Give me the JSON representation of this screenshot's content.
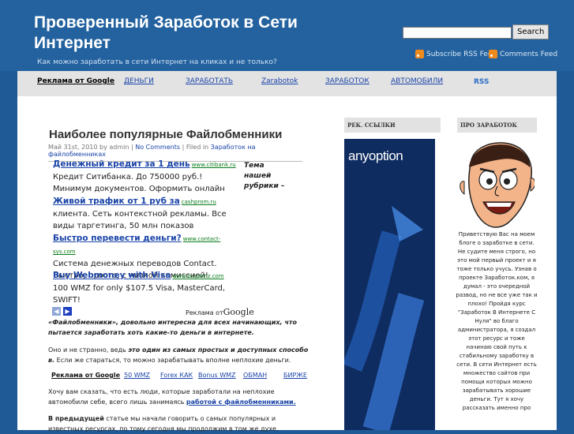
{
  "header": {
    "title": "Проверенный Заработок в Сети Интернет",
    "tagline": "Как можно заработать в сети Интернет на кликах и не только?",
    "search_button": "Search",
    "feed_rss": "Subscribe RSS Feed",
    "feed_comments": "Comments Feed"
  },
  "nav": {
    "items": [
      "Реклама от Google",
      "ДЕНЬГИ",
      "ЗАРАБОТАТЬ",
      "Zarabotok",
      "ЗАРАБОТОК",
      "АВТОМОБИЛИ"
    ],
    "rss": "RSS"
  },
  "post": {
    "title": "Наиболее популярные Файлобменники",
    "meta_date": "Май 31st, 2010 by admin |",
    "meta_comments": "No Comments",
    "meta_filed": "| Filed in",
    "meta_category": "Заработок на файлобменниках",
    "theme_box": "Тема нашей рубрики –"
  },
  "ads": [
    {
      "title": "Денежный кредит за 1 день",
      "url": "www.citibank.ru",
      "text": "Кредит Ситибанка. До 750000 руб.! Минимум документов. Оформить онлайн"
    },
    {
      "title": "Живой трафик от 1 руб за",
      "url": "cashprom.ru",
      "text": "клиента. Сеть контекстной рекламы. Все виды таргетинга, 50 млн показов"
    },
    {
      "title": "Быстро перевести деньги?",
      "url": "www.contact-sys.com",
      "text": "Система денежных переводов Contact. Быстро, просто, с низкой комиссией!"
    },
    {
      "title": "Buy Webmoney with Visa",
      "url": "www.buywmz.com",
      "text": "100 WMZ for only $107.5 Visa, MasterCard, SWIFT!"
    }
  ],
  "ads_label": {
    "prefix": "Реклама от",
    "brand": "Google"
  },
  "content": {
    "p1": "«Файлобменники», довольно интересна для всех начинающих, что пытается заработать хоть какие-то деньги в интернете.",
    "p2_a": "Оно и не странно, ведь",
    "p2_b": "это один из самых простых и доступных способо в.",
    "p2_c": "Если же стараться, то можно зарабатывать вполне неплохие деньги.",
    "p3_a": "Хочу вам сказать, что есть люди, которые заработали на неплохие автомобили себе, всего лишь занимаясь",
    "p3_link": "работой с файлобменниками.",
    "p4_a": "В предыдущей",
    "p4_b": "статье мы начали говорить о самых популярных и известных ресурсах, по тому сегодня мы продолжим в том же духе."
  },
  "link_units": [
    "Реклама от Google",
    "50 WMZ",
    "Forex КАК",
    "Bonus WMZ",
    "ОБМАН",
    "БИРЖЕ"
  ],
  "sidebar": {
    "left_title": "РЕК. ССЫЛКИ",
    "banner_logo": "anyoption",
    "right_title": "ПРО ЗАРАБОТОК",
    "about_text": "Приветствую Вас на моем блоге о заработке в сети. Не судите меня строго, но это мой первый проект и я тоже только учусь. Узнав о проекте Заработок.ком, я думал - это очередной развод, но не все уже так и плохо! Пройдя курс \"Заработок В Интернете С Нуля\" во благо администратора, я создал этот ресурс и тоже начинаю свой путь к стабильному заработку в сети. В сети Интернет есть множество сайтов при помощи которых можно зарабатывать хорошие деньги. Тут я хочу рассказать именно про"
  },
  "colors": {
    "background": "#1f5a96",
    "link": "#1a44a8",
    "banner": "#0f2c61",
    "rss": "#f08a1c"
  }
}
